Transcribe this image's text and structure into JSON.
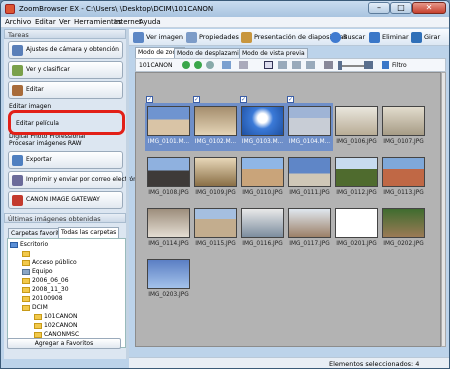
{
  "window": {
    "title": "ZoomBrowser EX  -  C:\\Users\\         \\Desktop\\DCIM\\101CANON",
    "minimize": "–",
    "maximize": "□",
    "close": "✕"
  },
  "menu": [
    "Archivo",
    "Editar",
    "Ver",
    "Herramientas",
    "Internet",
    "Ayuda"
  ],
  "left": {
    "tasks_header": "Tareas",
    "nav": [
      {
        "label": "Ajustes de cámara y obtención",
        "icon": "camera-icon",
        "color": "#5a7fb8"
      },
      {
        "label": "Ver y clasificar",
        "icon": "view-icon",
        "color": "#7aa04a"
      },
      {
        "label": "Editar",
        "icon": "edit-icon",
        "color": "#a86b3a"
      }
    ],
    "sub": [
      "Editar imagen",
      "Editar película",
      "Digital Photo Professional",
      "Procesar imágenes RAW"
    ],
    "nav2": [
      {
        "label": "Exportar",
        "icon": "export-icon",
        "color": "#4f7fc0"
      },
      {
        "label": "Imprimir y enviar por correo electrónico",
        "icon": "print-icon",
        "color": "#6b6b9a"
      },
      {
        "label": "CANON IMAGE GATEWAY",
        "icon": "gateway-icon",
        "color": "#c33a2d"
      }
    ],
    "recent_header": "Últimas imágenes obtenidas",
    "folder_tabs": [
      "Carpetas favoritas",
      "Todas las carpetas"
    ],
    "tree": [
      "Escritorio",
      "",
      "Acceso público",
      "Equipo",
      "2006_06_06",
      "2008_11_30",
      "20100908",
      "DCIM",
      "101CANON",
      "102CANON",
      "CANONMSC"
    ],
    "add_favorites": "Agregar a Favoritos"
  },
  "toolbar": {
    "view_image": "Ver imagen",
    "properties": "Propiedades",
    "slideshow": "Presentación de diapositivas",
    "search": "Buscar",
    "delete": "Eliminar",
    "rotate": "Girar"
  },
  "tabs": [
    "Modo de zoom",
    "Modo de desplazamiento",
    "Modo de vista previa"
  ],
  "subtool": {
    "folder": "101CANON",
    "filter": "Filtro"
  },
  "thumbs": [
    {
      "name": "IMG_0101.M...",
      "sel": true,
      "bg": "linear-gradient(#6f94d0 0 45%,#d9c4a6 45% 100%)"
    },
    {
      "name": "IMG_0102.M...",
      "sel": true,
      "bg": "linear-gradient(#a58e6e,#e4d4b6)"
    },
    {
      "name": "IMG_0103.M...",
      "sel": true,
      "bg": "radial-gradient(circle at 50% 40%,#fff 0 18%,#3b7ad8 40%,#1e4fa0)"
    },
    {
      "name": "IMG_0104.M...",
      "sel": true,
      "bg": "linear-gradient(#9fb4d6 0 40%,#c8cdd6 40% 100%)"
    },
    {
      "name": "IMG_0106.JPG",
      "sel": false,
      "bg": "linear-gradient(#e9e6dd,#b9ad96)"
    },
    {
      "name": "IMG_0107.JPG",
      "sel": false,
      "bg": "linear-gradient(#e2dccd,#a79c86)"
    },
    {
      "name": "IMG_0108.JPG",
      "sel": false,
      "bg": "linear-gradient(#8fb1df 0 45%,#3e3a38 45% 100%)"
    },
    {
      "name": "IMG_0109.JPG",
      "sel": false,
      "bg": "linear-gradient(#e7d7b8,#8a6f46)"
    },
    {
      "name": "IMG_0110.JPG",
      "sel": false,
      "bg": "linear-gradient(#8fb6e6 0 40%,#c9a47a 40% 100%)"
    },
    {
      "name": "IMG_0111.JPG",
      "sel": false,
      "bg": "linear-gradient(#5f86c7 0 55%,#cfc7b7 55% 100%)"
    },
    {
      "name": "IMG_0112.JPG",
      "sel": false,
      "bg": "linear-gradient(#c7dbef 0 40%,#4f6b2e 40% 100%)"
    },
    {
      "name": "IMG_0113.JPG",
      "sel": false,
      "bg": "linear-gradient(#7fa8d9 0 40%,#c06845 40% 100%)"
    },
    {
      "name": "IMG_0114.JPG",
      "sel": false,
      "bg": "linear-gradient(#9d8e7c,#e4ddd3)"
    },
    {
      "name": "IMG_0115.JPG",
      "sel": false,
      "bg": "linear-gradient(#a5bfe0 0 35%,#c3ad8e 35% 100%)"
    },
    {
      "name": "IMG_0116.JPG",
      "sel": false,
      "bg": "linear-gradient(#e9e9e9,#7c8d9e)"
    },
    {
      "name": "IMG_0117.JPG",
      "sel": false,
      "bg": "linear-gradient(#dfe7ef,#9c8068)"
    },
    {
      "name": "IMG_0201.JPG",
      "sel": false,
      "bg": "#ffffff"
    },
    {
      "name": "IMG_0202.JPG",
      "sel": false,
      "bg": "linear-gradient(#3f6c2f,#9b7a55)"
    },
    {
      "name": "IMG_0203.JPG",
      "sel": false,
      "bg": "linear-gradient(#5b7fc4,#a4c2ea)"
    }
  ],
  "status": "Elementos seleccionados: 4"
}
